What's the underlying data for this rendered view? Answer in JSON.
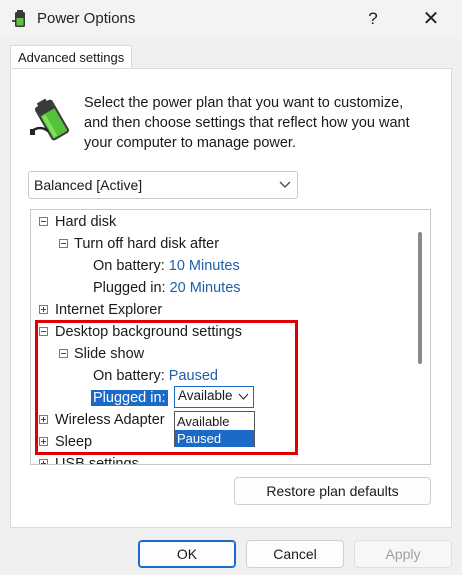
{
  "window": {
    "title": "Power Options",
    "help": "?",
    "close": "✕"
  },
  "tab": {
    "label": "Advanced settings"
  },
  "intro": {
    "text": "Select the power plan that you want to customize, and then choose settings that reflect how you want your computer to manage power."
  },
  "plan": {
    "value": "Balanced [Active]"
  },
  "tree": {
    "hard_disk": "Hard disk",
    "turn_off_hdd": "Turn off hard disk after",
    "hdd_battery_label": "On battery:",
    "hdd_battery_value": "10 Minutes",
    "hdd_plugged_label": "Plugged in:",
    "hdd_plugged_value": "20 Minutes",
    "internet_explorer": "Internet Explorer",
    "desktop_bg": "Desktop background settings",
    "slide_show": "Slide show",
    "ss_battery_label": "On battery:",
    "ss_battery_value": "Paused",
    "ss_plugged_label": "Plugged in:",
    "wireless": "Wireless Adapter",
    "sleep": "Sleep",
    "usb": "USB settings"
  },
  "dropdown": {
    "value": "Available",
    "options": [
      "Available",
      "Paused"
    ]
  },
  "buttons": {
    "restore": "Restore plan defaults",
    "ok": "OK",
    "cancel": "Cancel",
    "apply": "Apply"
  },
  "colors": {
    "accent": "#1b6ac7",
    "highlight_box": "#e00000",
    "value_text": "#1f5fa8"
  }
}
